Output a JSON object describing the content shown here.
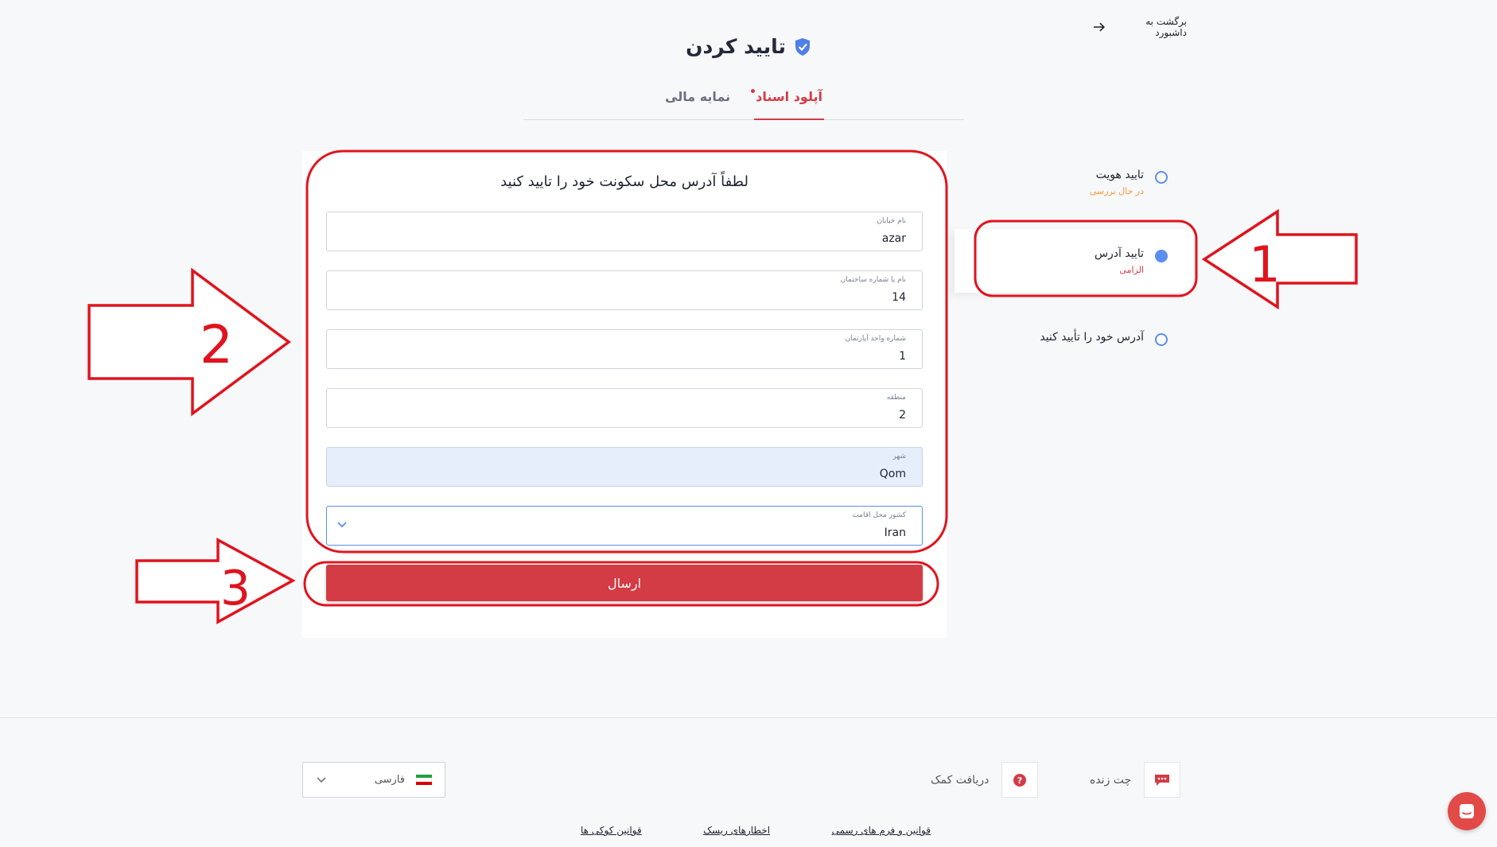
{
  "header": {
    "back_link": "برگشت به داشبورد",
    "title": "تایید کردن"
  },
  "tabs": [
    {
      "label": "آپلود اسناد",
      "active": true
    },
    {
      "label": "نمایه مالی",
      "active": false
    }
  ],
  "steps": [
    {
      "label": "تایید هویت",
      "sub": "در حال بررسی"
    },
    {
      "label": "تایید آدرس",
      "sub": "الزامی"
    },
    {
      "label": "آدرس خود را تأیید کنید",
      "sub": ""
    }
  ],
  "form": {
    "title": "لطفاً آدرس محل سکونت خود را تایید کنید",
    "fields": [
      {
        "label": "نام خیابان",
        "value": "azar"
      },
      {
        "label": "نام یا شماره ساختمان",
        "value": "14"
      },
      {
        "label": "شماره واحد آپارتمان",
        "value": "1"
      },
      {
        "label": "منطقه",
        "value": "2"
      },
      {
        "label": "شهر",
        "value": "Qom"
      },
      {
        "label": "کشور محل اقامت",
        "value": "Iran"
      }
    ],
    "submit_label": "ارسال"
  },
  "annotations": [
    {
      "number": "1"
    },
    {
      "number": "2"
    },
    {
      "number": "3"
    }
  ],
  "footer": {
    "language": "فارسی",
    "chat_label": "چت زنده",
    "support_label": "دریافت کمک",
    "links": [
      "قوانین و فرم های رسمی",
      "اخطارهای ریسک",
      "قوانین کوکی ها"
    ]
  },
  "colors": {
    "accent": "#d33b45",
    "blue": "#5b8ef0",
    "annotation": "#e0141e",
    "pending": "#f39a3a"
  }
}
